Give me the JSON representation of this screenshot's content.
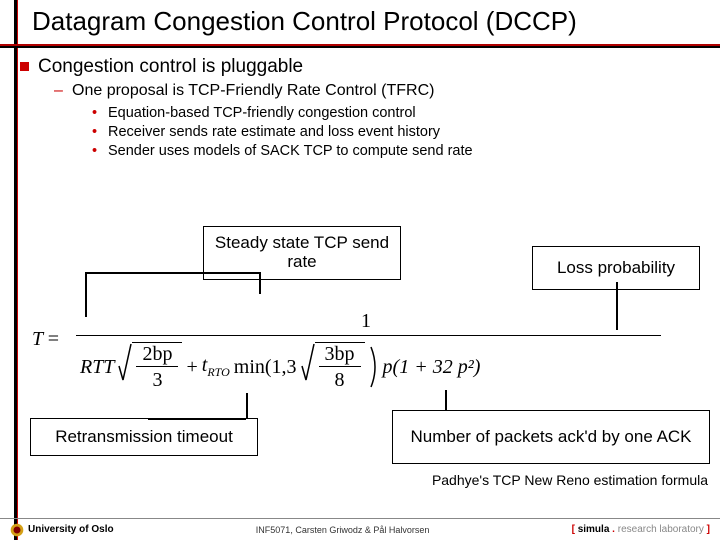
{
  "title": "Datagram Congestion Control Protocol (DCCP)",
  "content": {
    "l1": "Congestion control is pluggable",
    "l2": "One proposal is TCP-Friendly Rate Control (TFRC)",
    "l3": {
      "a": "Equation-based TCP-friendly congestion control",
      "b": "Receiver sends rate estimate and loss event history",
      "c": "Sender uses models of SACK TCP to compute send rate"
    }
  },
  "boxes": {
    "steady": "Steady state TCP send rate",
    "loss": "Loss probability",
    "rto": "Retransmission timeout",
    "ack": "Number of packets ack'd by one ACK"
  },
  "formula": {
    "T": "T",
    "eq": "=",
    "num_top": "1",
    "rtt": "RTT",
    "frac1_num": "2bp",
    "frac1_den": "3",
    "plus": "+",
    "trto": "t",
    "rto_sub": "RTO",
    "min": "min(1,3",
    "frac2_num": "3bp",
    "frac2_den": "8",
    "close_min": ")",
    "tail": "p(1 + 32 p²)"
  },
  "caption": "Padhye's TCP New Reno estimation formula",
  "footer": {
    "left": "University of Oslo",
    "center": "INF5071, Carsten Griwodz & Pål Halvorsen",
    "right_b1": "[ ",
    "right_sim": "simula",
    "right_dot": " . ",
    "right_rl": "research laboratory",
    "right_b2": " ]"
  }
}
